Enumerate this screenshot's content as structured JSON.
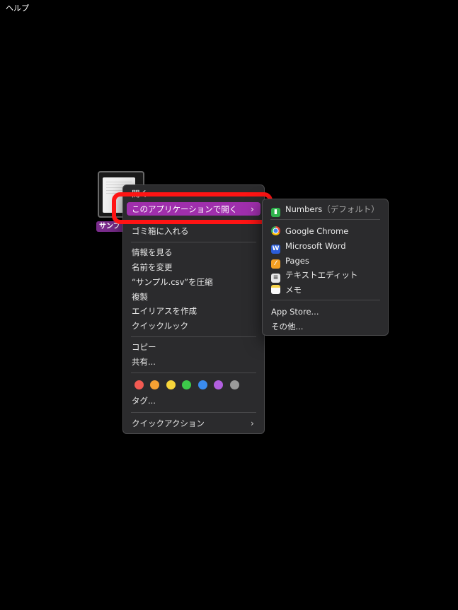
{
  "menubar": {
    "help_label": "ヘルプ"
  },
  "file": {
    "name_visible": "サンプ"
  },
  "context_menu": {
    "partial_top": "開く",
    "open_with": "このアプリケーションで開く",
    "trash": "ゴミ箱に入れる",
    "get_info": "情報を見る",
    "rename": "名前を変更",
    "compress": "“サンプル.csv”を圧縮",
    "duplicate": "複製",
    "make_alias": "エイリアスを作成",
    "quick_look": "クイックルック",
    "copy": "コピー",
    "share": "共有...",
    "tags": "タグ...",
    "quick_actions": "クイックアクション",
    "tag_colors": [
      "#f25a52",
      "#f5a033",
      "#f7d53a",
      "#3dca4a",
      "#3a8cf0",
      "#b25fe0",
      "#9a9a9a"
    ]
  },
  "open_with_submenu": {
    "default_app": "Numbers",
    "default_suffix": "（デフォルト）",
    "apps": [
      {
        "label": "Google Chrome",
        "icon": "chrome-icon"
      },
      {
        "label": "Microsoft Word",
        "icon": "word-icon"
      },
      {
        "label": "Pages",
        "icon": "pages-icon"
      },
      {
        "label": "テキストエディット",
        "icon": "textedit-icon"
      },
      {
        "label": "メモ",
        "icon": "notes-icon"
      }
    ],
    "app_store": "App Store...",
    "other": "その他..."
  }
}
